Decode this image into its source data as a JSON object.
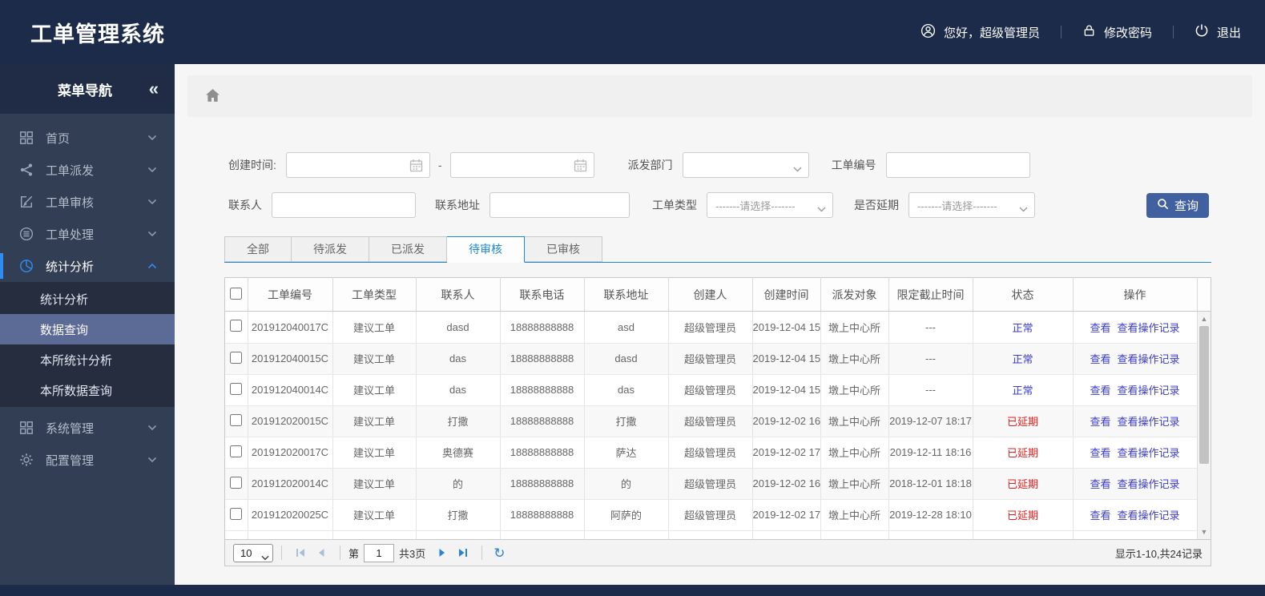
{
  "colors": {
    "header_bg": "#1c2b4a",
    "sidebar_bg": "#323e54",
    "accent_blue": "#2e8df0",
    "submenu_selected_bg": "#5c6b96",
    "tab_active_blue": "#1e88c8",
    "link_blue": "#3c3ccd",
    "status_normal_blue": "#3c3ccd",
    "status_delayed_red": "#e01f1f",
    "search_button_bg": "#40609f",
    "pager_icon_blue": "#2a82d4"
  },
  "header": {
    "title": "工单管理系统",
    "user_greeting": "您好，超级管理员",
    "change_password": "修改密码",
    "logout": "退出"
  },
  "sidebar": {
    "title": "菜单导航",
    "collapse_glyph": "«",
    "items": [
      {
        "label": "首页"
      },
      {
        "label": "工单派发"
      },
      {
        "label": "工单审核"
      },
      {
        "label": "工单处理"
      },
      {
        "label": "统计分析"
      },
      {
        "label": "系统管理"
      },
      {
        "label": "配置管理"
      }
    ],
    "submenu": {
      "items": [
        "统计分析",
        "数据查询",
        "本所统计分析",
        "本所数据查询"
      ],
      "selected": "数据查询"
    }
  },
  "filters": {
    "create_time_label": "创建时间:",
    "range_separator": "-",
    "dispatch_dept_label": "派发部门",
    "order_no_label": "工单编号",
    "contact_label": "联系人",
    "address_label": "联系地址",
    "order_type_label": "工单类型",
    "delayed_label": "是否延期",
    "select_placeholder": "-------请选择-------",
    "search_button_label": "查询"
  },
  "tabs": {
    "labels": [
      "全部",
      "待派发",
      "已派发",
      "待审核",
      "已审核"
    ],
    "active": "待审核"
  },
  "table": {
    "columns": [
      "工单编号",
      "工单类型",
      "联系人",
      "联系电话",
      "联系地址",
      "创建人",
      "创建时间",
      "派发对象",
      "限定截止时间",
      "状态",
      "操作"
    ],
    "actions": [
      "查看",
      "查看操作记录"
    ],
    "rows": [
      {
        "order_no": "201912040017C",
        "order_type": "建议工单",
        "contact": "dasd",
        "phone": "18888888888",
        "address": "asd",
        "creator": "超级管理员",
        "created_at": "2019-12-04 15",
        "dispatch_target": "墩上中心所",
        "deadline": "---",
        "status": "正常",
        "status_kind": "normal"
      },
      {
        "order_no": "201912040015C",
        "order_type": "建议工单",
        "contact": "das",
        "phone": "18888888888",
        "address": "dasd",
        "creator": "超级管理员",
        "created_at": "2019-12-04 15",
        "dispatch_target": "墩上中心所",
        "deadline": "---",
        "status": "正常",
        "status_kind": "normal"
      },
      {
        "order_no": "201912040014C",
        "order_type": "建议工单",
        "contact": "das",
        "phone": "18888888888",
        "address": "das",
        "creator": "超级管理员",
        "created_at": "2019-12-04 15",
        "dispatch_target": "墩上中心所",
        "deadline": "---",
        "status": "正常",
        "status_kind": "normal"
      },
      {
        "order_no": "201912020015C",
        "order_type": "建议工单",
        "contact": "打撒",
        "phone": "18888888888",
        "address": "打撒",
        "creator": "超级管理员",
        "created_at": "2019-12-02 16",
        "dispatch_target": "墩上中心所",
        "deadline": "2019-12-07 18:17",
        "status": "已延期",
        "status_kind": "delayed"
      },
      {
        "order_no": "201912020017C",
        "order_type": "建议工单",
        "contact": "奥德赛",
        "phone": "18888888888",
        "address": "萨达",
        "creator": "超级管理员",
        "created_at": "2019-12-02 17",
        "dispatch_target": "墩上中心所",
        "deadline": "2019-12-11 18:16",
        "status": "已延期",
        "status_kind": "delayed"
      },
      {
        "order_no": "201912020014C",
        "order_type": "建议工单",
        "contact": "的",
        "phone": "18888888888",
        "address": "的",
        "creator": "超级管理员",
        "created_at": "2019-12-02 16",
        "dispatch_target": "墩上中心所",
        "deadline": "2018-12-01 18:18",
        "status": "已延期",
        "status_kind": "delayed"
      },
      {
        "order_no": "201912020025C",
        "order_type": "建议工单",
        "contact": "打撒",
        "phone": "18888888888",
        "address": "阿萨的",
        "creator": "超级管理员",
        "created_at": "2019-12-02 17",
        "dispatch_target": "墩上中心所",
        "deadline": "2019-12-28 18:10",
        "status": "已延期",
        "status_kind": "delayed"
      }
    ]
  },
  "pagination": {
    "page_size": "10",
    "page_prefix": "第",
    "current_page": "1",
    "total_pages": "共3页",
    "records_summary": "显示1-10,共24记录"
  }
}
